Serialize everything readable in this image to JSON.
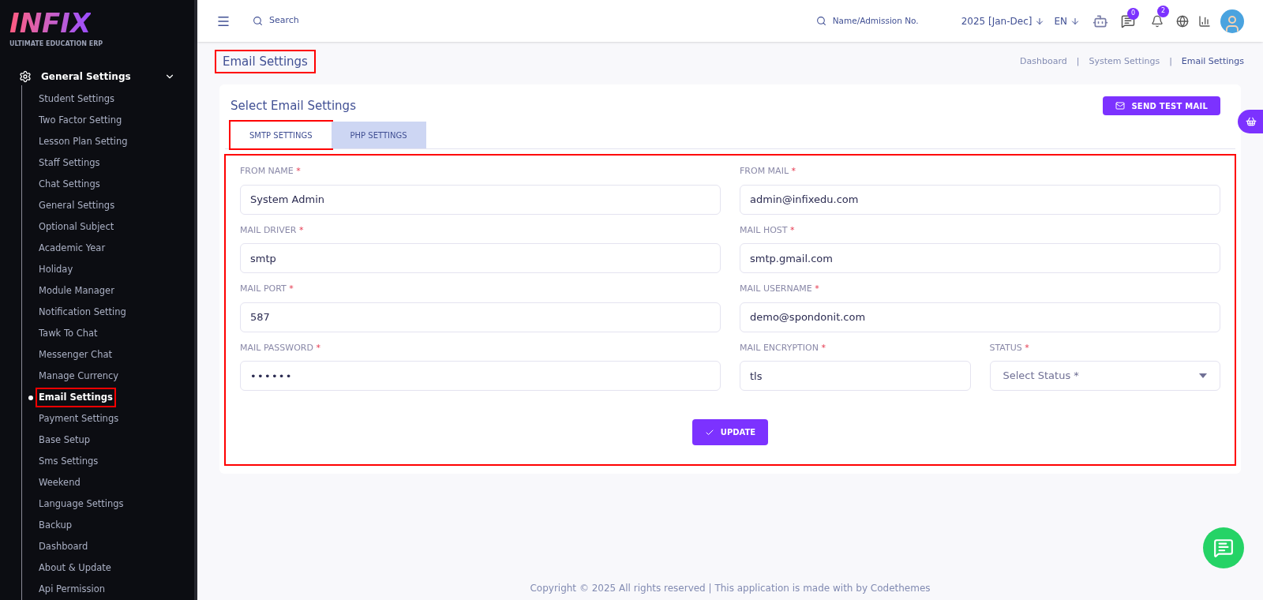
{
  "logo": {
    "name": "INFIX",
    "tagline": "ULTIMATE EDUCATION ERP"
  },
  "sidebar": {
    "group": {
      "label": "General Settings",
      "expanded": true
    },
    "items": [
      {
        "label": "Student Settings",
        "selected": false,
        "annotated": false
      },
      {
        "label": "Two Factor Setting",
        "selected": false,
        "annotated": false
      },
      {
        "label": "Lesson Plan Setting",
        "selected": false,
        "annotated": false
      },
      {
        "label": "Staff Settings",
        "selected": false,
        "annotated": false
      },
      {
        "label": "Chat Settings",
        "selected": false,
        "annotated": false
      },
      {
        "label": "General Settings",
        "selected": false,
        "annotated": false
      },
      {
        "label": "Optional Subject",
        "selected": false,
        "annotated": false
      },
      {
        "label": "Academic Year",
        "selected": false,
        "annotated": false
      },
      {
        "label": "Holiday",
        "selected": false,
        "annotated": false
      },
      {
        "label": "Module Manager",
        "selected": false,
        "annotated": false
      },
      {
        "label": "Notification Setting",
        "selected": false,
        "annotated": false
      },
      {
        "label": "Tawk To Chat",
        "selected": false,
        "annotated": false
      },
      {
        "label": "Messenger Chat",
        "selected": false,
        "annotated": false
      },
      {
        "label": "Manage Currency",
        "selected": false,
        "annotated": false
      },
      {
        "label": "Email Settings",
        "selected": true,
        "annotated": true
      },
      {
        "label": "Payment Settings",
        "selected": false,
        "annotated": false
      },
      {
        "label": "Base Setup",
        "selected": false,
        "annotated": false
      },
      {
        "label": "Sms Settings",
        "selected": false,
        "annotated": false
      },
      {
        "label": "Weekend",
        "selected": false,
        "annotated": false
      },
      {
        "label": "Language Settings",
        "selected": false,
        "annotated": false
      },
      {
        "label": "Backup",
        "selected": false,
        "annotated": false
      },
      {
        "label": "Dashboard",
        "selected": false,
        "annotated": false
      },
      {
        "label": "About & Update",
        "selected": false,
        "annotated": false
      },
      {
        "label": "Api Permission",
        "selected": false,
        "annotated": false
      }
    ]
  },
  "topbar": {
    "search_placeholder": "Search",
    "student_search_placeholder": "Name/Admission No.",
    "year": "2025 [Jan-Dec]",
    "language": "EN",
    "messages_count": "0",
    "notifications_count": "2"
  },
  "page": {
    "title": "Email Settings",
    "title_annotated": true,
    "breadcrumb_separator": "|",
    "breadcrumb": [
      {
        "label": "Dashboard",
        "selected": false
      },
      {
        "label": "System Settings",
        "selected": false
      },
      {
        "label": "Email Settings",
        "selected": true
      }
    ]
  },
  "card": {
    "title": "Select Email Settings",
    "test_button": "SEND TEST MAIL",
    "tabs": [
      {
        "label": "SMTP SETTINGS",
        "selected": true,
        "annotated": true
      },
      {
        "label": "PHP SETTINGS",
        "selected": false,
        "annotated": false
      }
    ],
    "form_annotated": true,
    "fields": [
      {
        "label": "FROM NAME",
        "required": "*",
        "kind": "text",
        "value": "System Admin"
      },
      {
        "label": "FROM MAIL",
        "required": "*",
        "kind": "text",
        "value": "admin@infixedu.com"
      },
      {
        "label": "MAIL DRIVER",
        "required": "*",
        "kind": "text",
        "value": "smtp"
      },
      {
        "label": "MAIL HOST",
        "required": "*",
        "kind": "text",
        "value": "smtp.gmail.com"
      },
      {
        "label": "MAIL PORT",
        "required": "*",
        "kind": "text",
        "value": "587"
      },
      {
        "label": "MAIL USERNAME",
        "required": "*",
        "kind": "text",
        "value": "demo@spondonit.com"
      },
      {
        "label": "MAIL PASSWORD",
        "required": "*",
        "kind": "password",
        "value": "••••••"
      },
      {
        "label": "MAIL ENCRYPTION",
        "required": "*",
        "kind": "text",
        "value": "tls"
      },
      {
        "label": "STATUS",
        "required": "*",
        "kind": "select",
        "placeholder": "Select Status *"
      }
    ],
    "update_button": "UPDATE"
  },
  "footer": "Copyright © 2025 All rights reserved | This application is made with by Codethemes"
}
